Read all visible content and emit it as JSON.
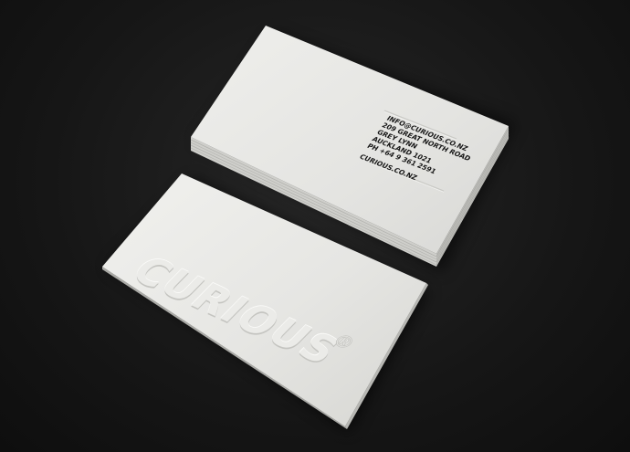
{
  "back_card": {
    "lines": [
      "INFO@CURIOUS.CO.NZ",
      "209 GREAT NORTH ROAD",
      "GREY LYNN",
      "AUCKLAND 1021",
      "PH +64 9 361 2591"
    ],
    "website": "CURIOUS.CO.NZ"
  },
  "front_card": {
    "logo_text": "CURIOUS",
    "logo_mark": "®"
  },
  "colors": {
    "background": "#161616",
    "card": "#e6e6e3",
    "text": "#161616"
  }
}
